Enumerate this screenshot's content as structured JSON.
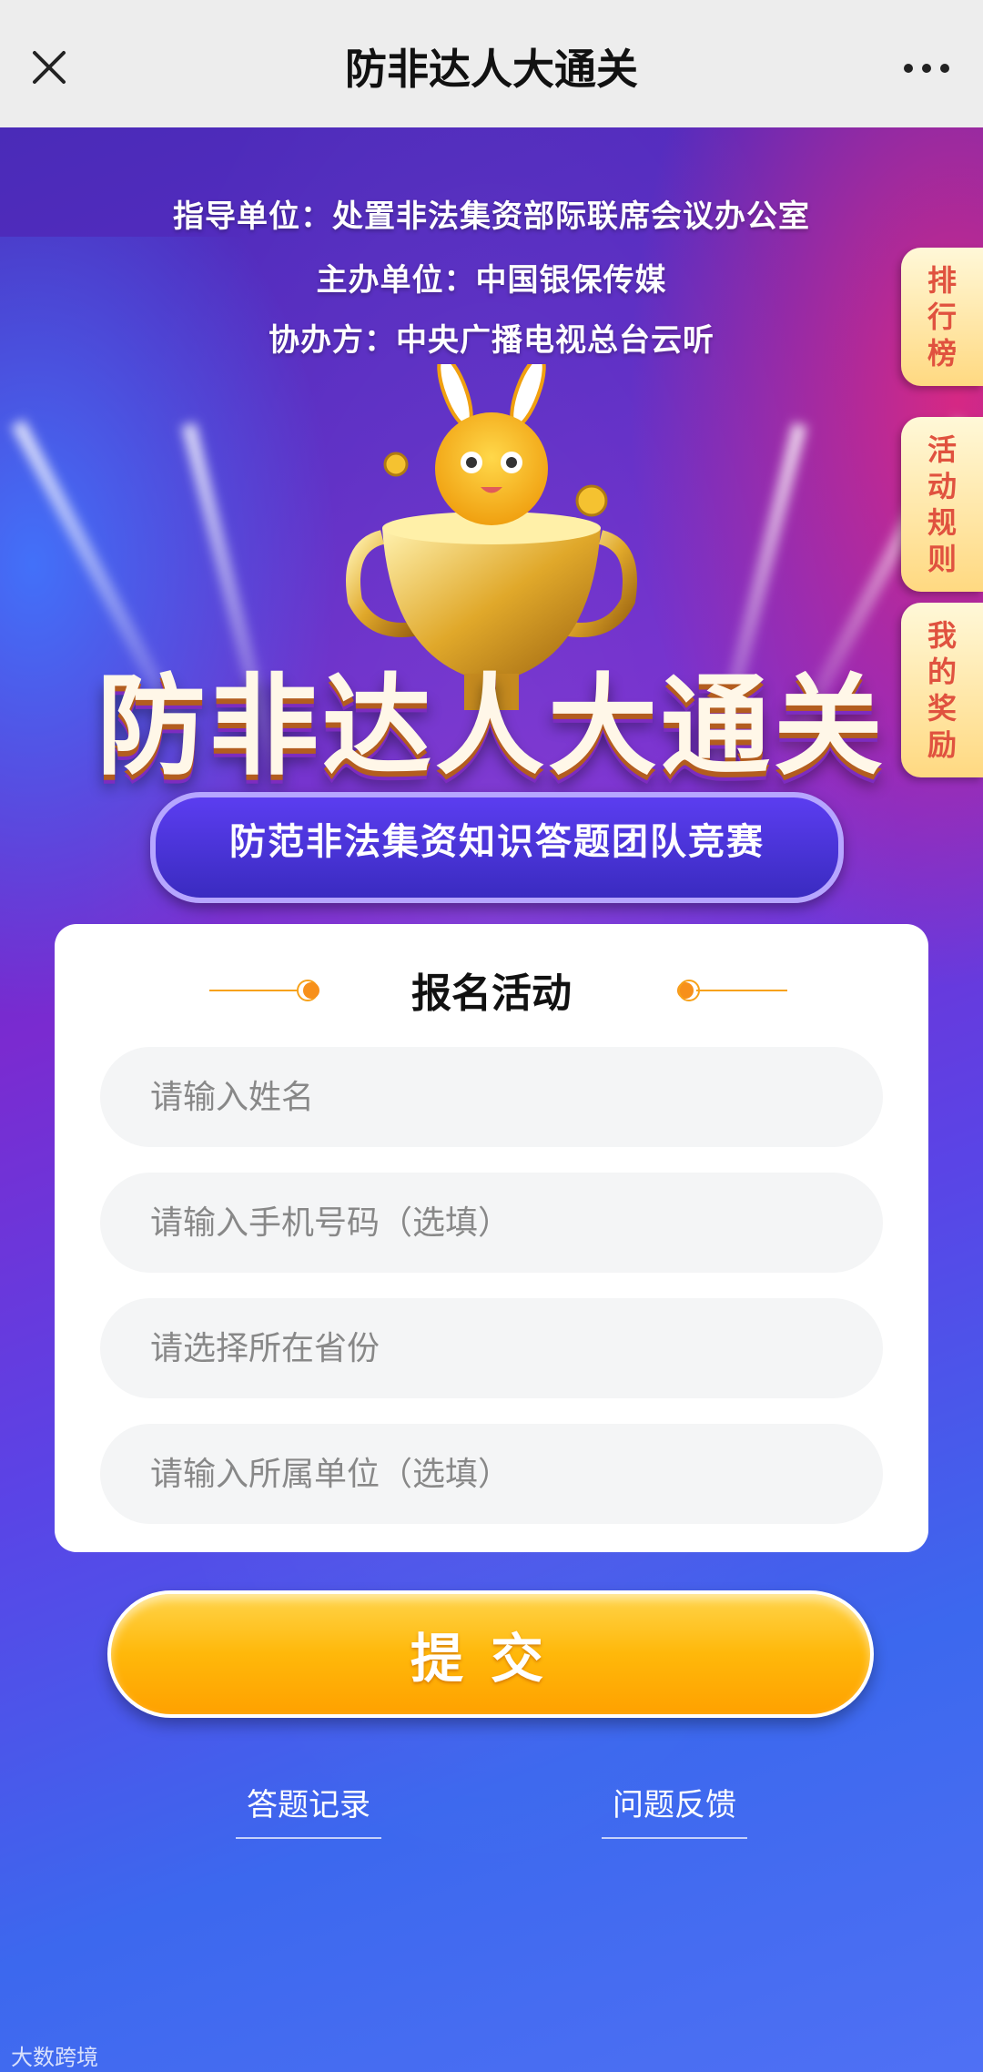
{
  "header": {
    "title": "防非达人大通关",
    "close_icon": "close-icon",
    "more_icon": "more-dots-icon"
  },
  "banner": {
    "guide_unit": "指导单位：处置非法集资部际联席会议办公室",
    "host_unit": "主办单位：中国银保传媒",
    "co_host": "协办方：中央广播电视总台云听",
    "main_title": "防非达人大通关",
    "subtitle": "防范非法集资知识答题团队竞赛"
  },
  "side_tabs": [
    {
      "label": "排行榜"
    },
    {
      "label": "活动规则"
    },
    {
      "label": "我的奖励"
    }
  ],
  "form": {
    "heading": "报名活动",
    "fields": [
      {
        "placeholder": "请输入姓名",
        "value": ""
      },
      {
        "placeholder": "请输入手机号码（选填）",
        "value": ""
      },
      {
        "placeholder": "请选择所在省份",
        "value": ""
      },
      {
        "placeholder": "请输入所属单位（选填）",
        "value": ""
      }
    ],
    "submit_label": "提交"
  },
  "footer_links": {
    "records": "答题记录",
    "feedback": "问题反馈"
  },
  "watermark": "大数跨境",
  "colors": {
    "accent_orange": "#ffb80a",
    "side_tab_text": "#e0523f",
    "topbar_bg": "#ededed"
  }
}
